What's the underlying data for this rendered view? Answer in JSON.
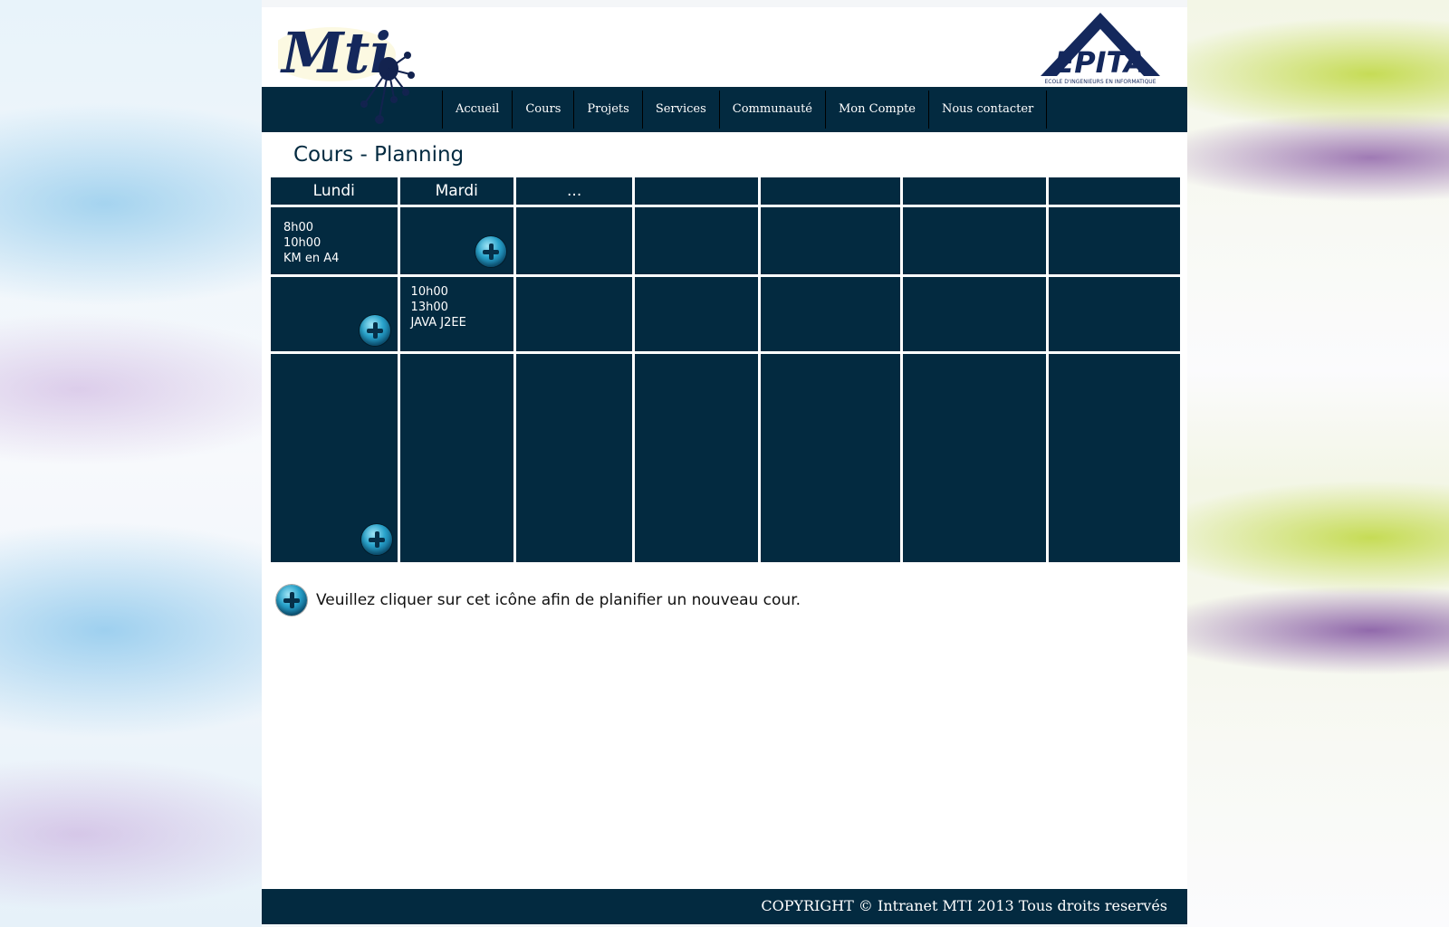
{
  "header": {
    "logo_left_text": "Mti",
    "logo_right_text": "EPITA",
    "logo_right_tagline": "ECOLE D'INGENIEURS EN INFORMATIQUE"
  },
  "nav": {
    "items": [
      "Accueil",
      "Cours",
      "Projets",
      "Services",
      "Communauté",
      "Mon Compte",
      "Nous contacter"
    ]
  },
  "page": {
    "title": "Cours - Planning"
  },
  "planning": {
    "days": [
      "Lundi",
      "Mardi",
      "...",
      "",
      "",
      "",
      ""
    ],
    "events": [
      {
        "start": "8h00",
        "end": "10h00",
        "name": "KM en A4"
      },
      {
        "start": "10h00",
        "end": "13h00",
        "name": "JAVA J2EE"
      }
    ]
  },
  "instruction": {
    "text": "Veuillez cliquer sur cet icône afin de planifier un nouveau cour."
  },
  "footer": {
    "copyright": "COPYRIGHT © Intranet MTI 2013 Tous droits reservés"
  },
  "colors": {
    "primary": "#032a40",
    "plus_icon": "#2aa4cc"
  }
}
